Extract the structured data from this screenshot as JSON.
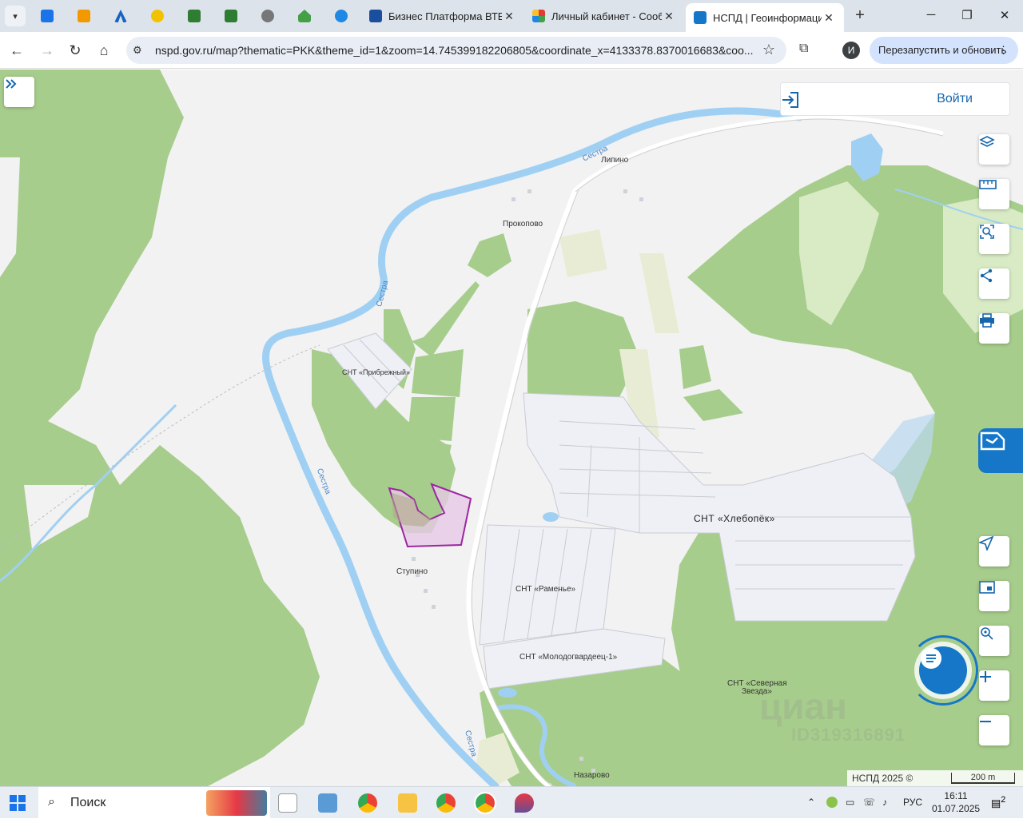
{
  "browser": {
    "tabs": [
      {
        "title": "Бизнес Платформа ВТБ",
        "active": false
      },
      {
        "title": "Личный кабинет - Сооб",
        "active": false
      },
      {
        "title": "НСПД | Геоинформацио",
        "active": true
      }
    ],
    "address": {
      "url": "nspd.gov.ru/map?thematic=PKK&theme_id=1&zoom=14.745399182206805&coordinate_x=4133378.8370016683&coo..."
    },
    "profile_initial": "И",
    "relaunch_label": "Перезапустить и обновить"
  },
  "map": {
    "login_label": "Войти",
    "labels": {
      "prokopovo": "Прокопово",
      "lipino": "Липино",
      "snt_pribrezhny": "СНТ «Прибрежный»",
      "snt_hlebopek": "СНТ «Хлебопёк»",
      "stupino": "Ступино",
      "snt_ramenye": "СНТ «Раменье»",
      "snt_molodogvardeets": "СНТ «Молодогвардеец-1»",
      "snt_severnaya_1": "СНТ «Северная",
      "snt_severnaya_2": "Звезда»",
      "nazarovo": "Назарово",
      "river_1": "Сестра",
      "river_2": "Сестра",
      "river_3": "Сестра",
      "river_4": "Сестра"
    },
    "copyright": "НСПД 2025 ©",
    "scale_label": "200 m",
    "watermark": "циан",
    "watermark_id": "ID319316891",
    "colors": {
      "forest": "#a7cd8c",
      "meadow": "#d8ebc4",
      "water": "#9fd0f3",
      "river_label": "#4a86c8",
      "parcel_fill": "#e6c9e6",
      "parcel_stroke": "#9b27a0",
      "accent": "#1677c8"
    }
  },
  "taskbar": {
    "search_label": "Поиск",
    "language": "РУС",
    "time": "16:11",
    "date": "01.07.2025",
    "notifications": "2"
  }
}
